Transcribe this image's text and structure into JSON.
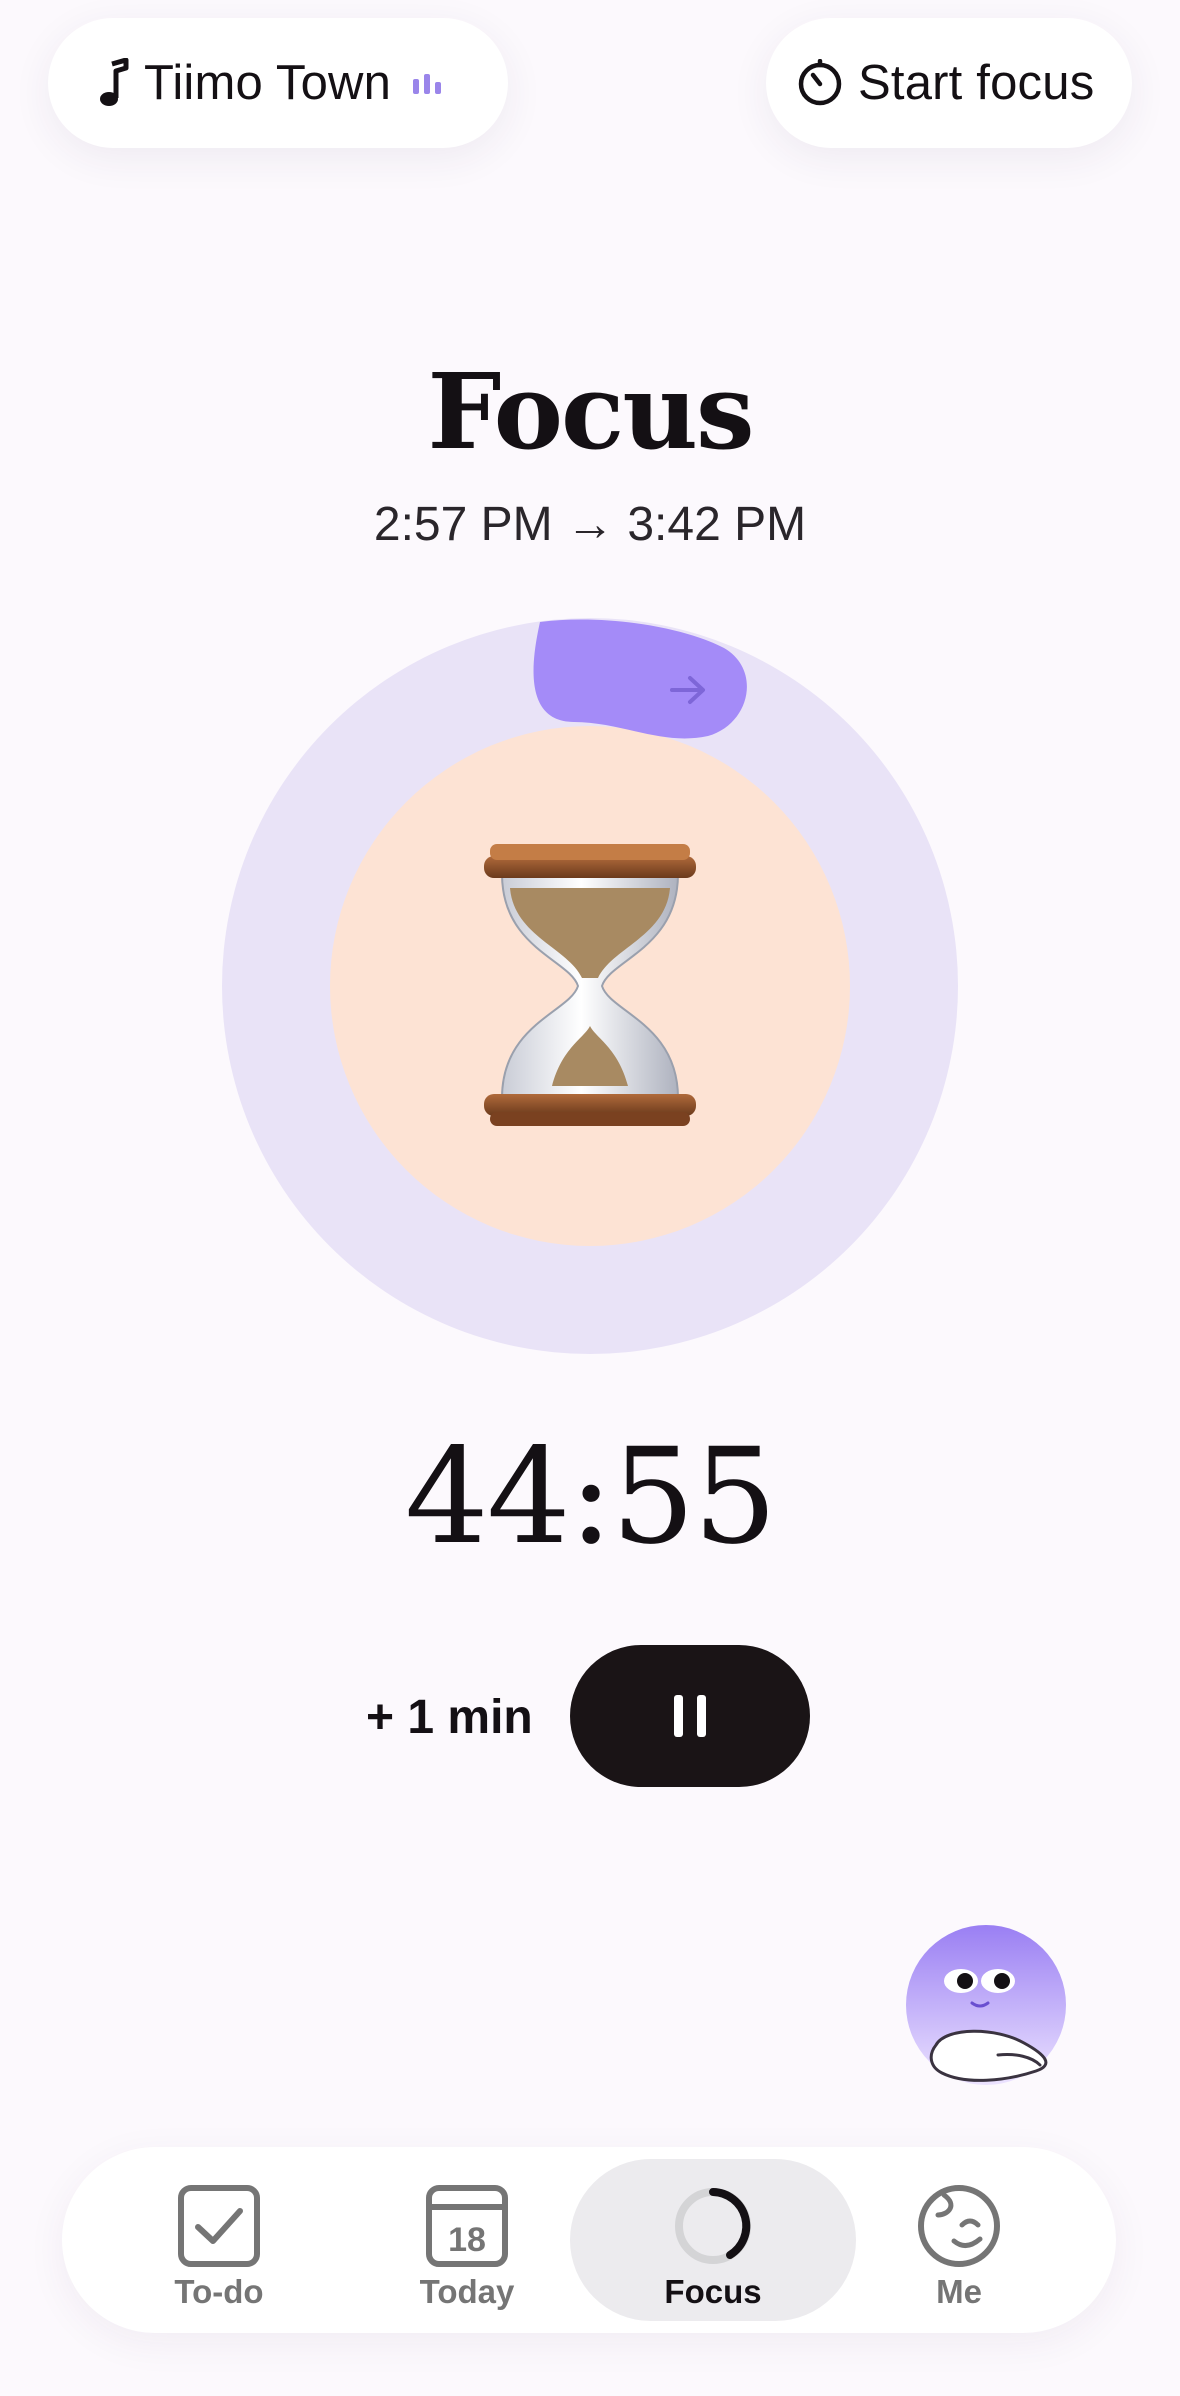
{
  "header": {
    "music": {
      "label": "Tiimo Town",
      "icon": "music-note-icon",
      "playing_icon": "equalizer-icon"
    },
    "start_focus": {
      "label": "Start focus",
      "icon": "timer-icon"
    }
  },
  "session": {
    "title": "Focus",
    "start_time": "2:57 PM",
    "arrow": "→",
    "end_time": "3:42 PM",
    "emoji": "hourglass-icon",
    "countdown": "44:55",
    "progress_fraction": 0.0
  },
  "controls": {
    "add_minute_label": "+ 1 min",
    "pause_icon": "pause-icon"
  },
  "assistant": {
    "icon": "buddy-avatar-icon"
  },
  "tabs": [
    {
      "label": "To-do",
      "icon": "checkbox-icon",
      "active": false
    },
    {
      "label": "Today",
      "icon": "calendar-icon",
      "day": "18",
      "active": false
    },
    {
      "label": "Focus",
      "icon": "focus-ring-icon",
      "active": true
    },
    {
      "label": "Me",
      "icon": "face-icon",
      "active": false
    }
  ],
  "colors": {
    "background": "#fcf9fd",
    "ring": "#e9e3f7",
    "inner": "#fde3d4",
    "accent": "#a48bf8",
    "dark": "#1a1416"
  }
}
